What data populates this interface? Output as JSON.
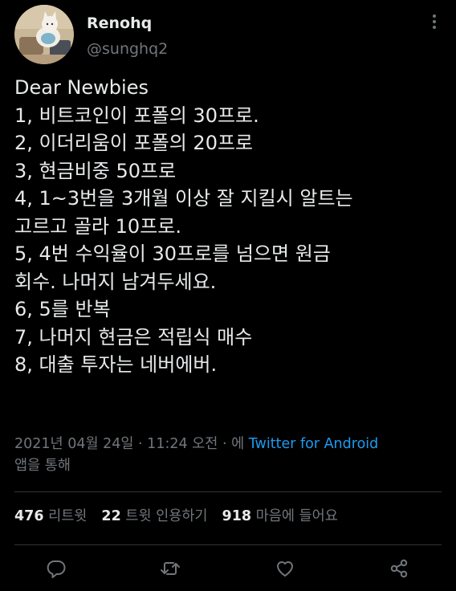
{
  "tweet": {
    "display_name": "Renohq",
    "handle": "@sunghq2",
    "body_lines": [
      "Dear Newbies",
      "1, 비트코인이 포폴의 30프로.",
      "2, 이더리움이 포폴의 20프로",
      "3, 현금비중 50프로",
      "4, 1~3번을 3개월 이상 잘 지킬시 알트는",
      "고르고 골라 10프로.",
      "5, 4번 수익율이 30프로를 넘으면 원금",
      "회수. 나머지 남겨두세요.",
      "6, 5를 반복",
      "7, 나머지 현금은 적립식 매수",
      "8, 대출 투자는 네버에버."
    ],
    "timestamp": "2021년 04월 24일 · 11:24 오전 · 에",
    "via": "Twitter for Android",
    "via_suffix": "앱을 통해"
  },
  "stats": {
    "retweets": {
      "count": "476",
      "label": "리트윗"
    },
    "quotes": {
      "count": "22",
      "label": "트윗 인용하기"
    },
    "likes": {
      "count": "918",
      "label": "마음에 들어요"
    }
  },
  "actions": [
    {
      "name": "reply",
      "icon": "speech-bubble-icon"
    },
    {
      "name": "retweet",
      "icon": "retweet-arrows-icon"
    },
    {
      "name": "like",
      "icon": "heart-icon"
    },
    {
      "name": "share",
      "icon": "share-nodes-icon"
    }
  ],
  "colors": {
    "background": "#000000",
    "text": "#e7e9ea",
    "secondary": "#71767b",
    "link": "#1d9bf0",
    "divider": "#2f3336"
  }
}
